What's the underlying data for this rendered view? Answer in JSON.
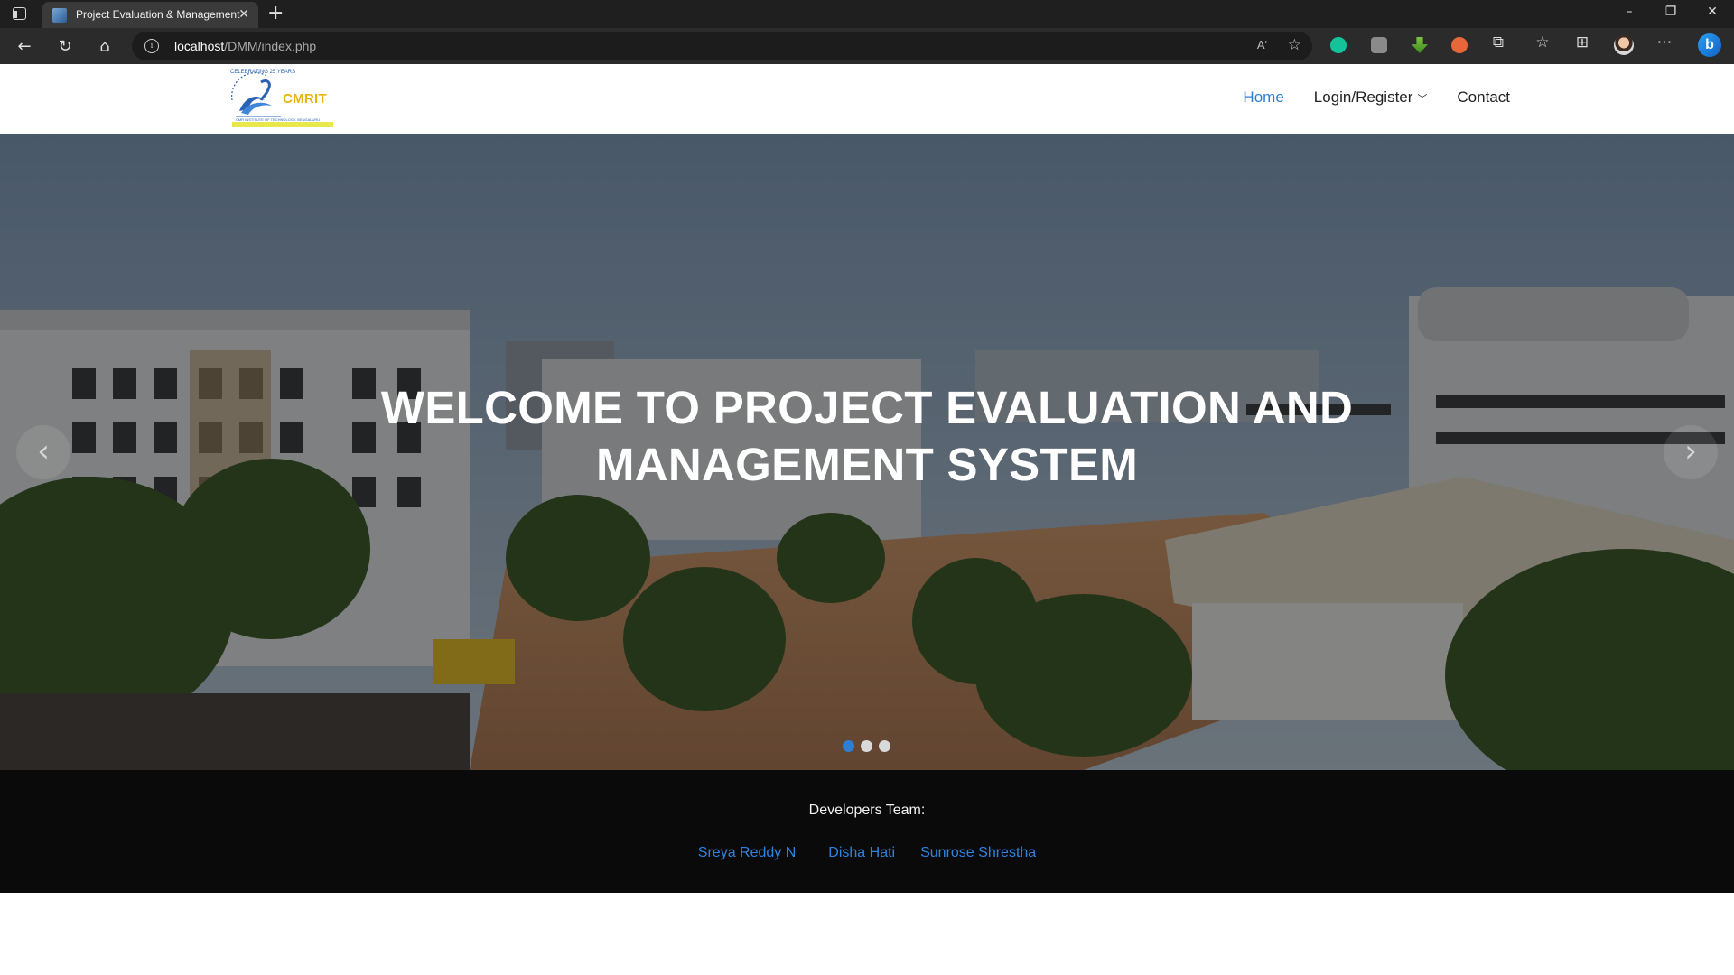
{
  "browser": {
    "tab_title": "Project Evaluation & Management",
    "url_host": "localhost",
    "url_path": "/DMM/index.php",
    "read_aloud_label": "Aʹ",
    "icons": [
      "tab-actions-icon",
      "back-icon",
      "refresh-icon",
      "home-icon",
      "site-info-icon",
      "read-aloud-icon",
      "add-favorite-icon",
      "grammarly-icon",
      "extension-gray-icon",
      "download-extension-icon",
      "extension-orange-icon",
      "extensions-icon",
      "favorites-icon",
      "collections-icon",
      "profile-avatar",
      "more-icon",
      "bing-icon"
    ]
  },
  "site": {
    "logo": {
      "name": "CMRIT",
      "arc_text": "CELEBRATING 25 YEARS"
    },
    "nav": {
      "home": "Home",
      "login_register": "Login/Register",
      "contact": "Contact"
    },
    "hero": {
      "title_line1": "WELCOME TO PROJECT EVALUATION AND",
      "title_line2": "MANAGEMENT SYSTEM",
      "slide_count": 3,
      "active_slide": 1
    },
    "footer": {
      "heading": "Developers Team:",
      "developers": [
        "Sreya Reddy N",
        "Disha Hati",
        "Sunrose Shrestha"
      ]
    }
  },
  "colors": {
    "accent": "#2d7fd6",
    "footer_bg": "#0a0a0a",
    "logo_gold": "#e8b50c"
  }
}
